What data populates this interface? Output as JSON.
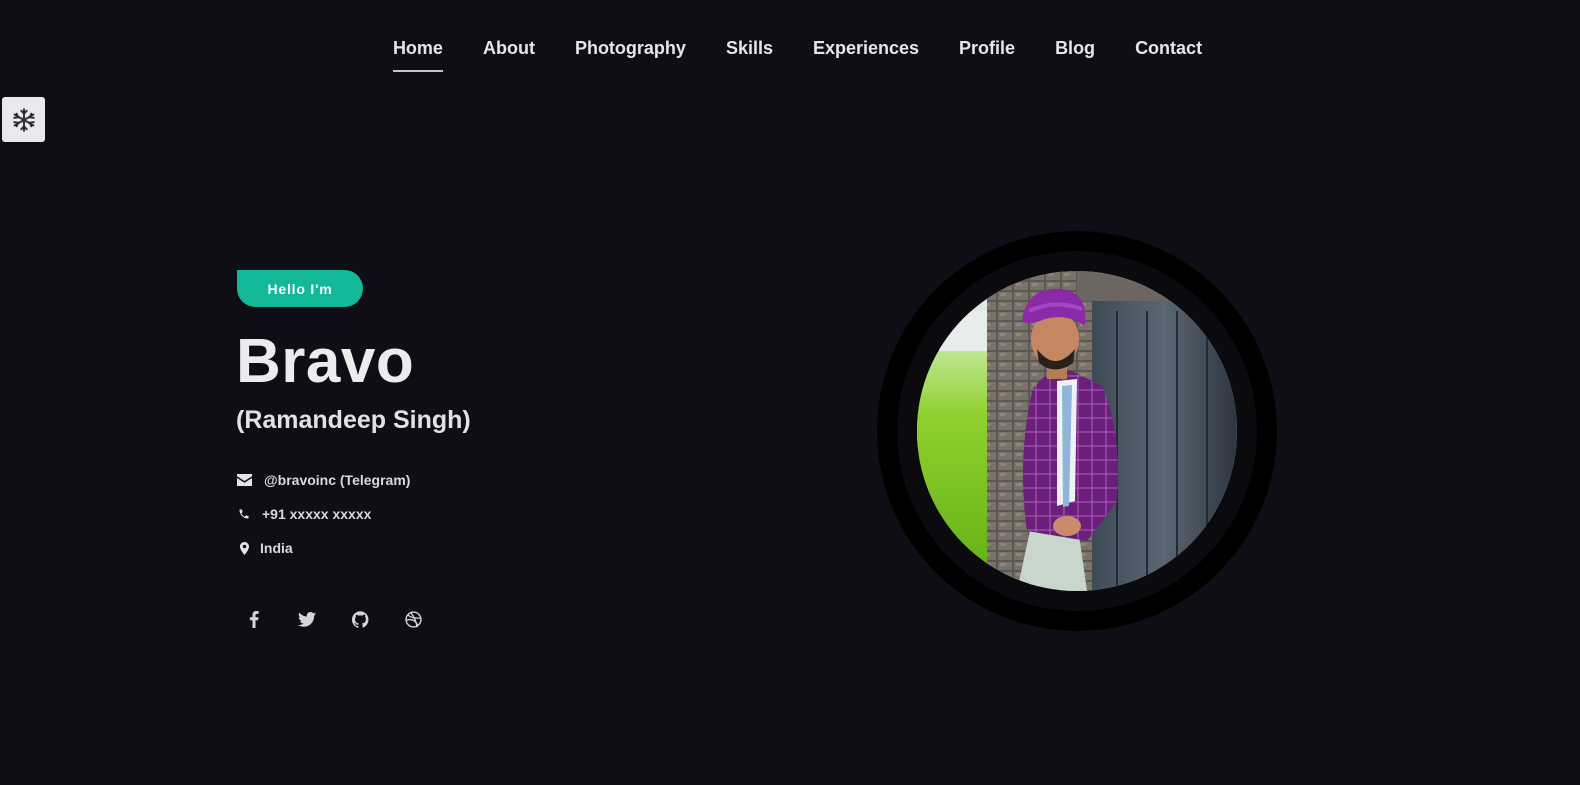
{
  "nav": {
    "items": [
      {
        "label": "Home",
        "active": true
      },
      {
        "label": "About"
      },
      {
        "label": "Photography"
      },
      {
        "label": "Skills"
      },
      {
        "label": "Experiences"
      },
      {
        "label": "Profile"
      },
      {
        "label": "Blog"
      },
      {
        "label": "Contact"
      }
    ]
  },
  "theme_toggle": {
    "icon": "snowflake-icon"
  },
  "hero": {
    "badge": "Hello I'm",
    "name": "Bravo",
    "real_name": "(Ramandeep Singh)",
    "contacts": [
      {
        "icon": "envelope-icon",
        "text": "@bravoinc (Telegram)"
      },
      {
        "icon": "phone-icon",
        "text": "+91 xxxxx xxxxx"
      },
      {
        "icon": "map-marker-icon",
        "text": "India"
      }
    ],
    "social": [
      "facebook-icon",
      "twitter-icon",
      "github-icon",
      "dribbble-icon"
    ]
  },
  "colors": {
    "background": "#0f0e16",
    "accent": "#12b898",
    "text": "#e8e8ec"
  }
}
